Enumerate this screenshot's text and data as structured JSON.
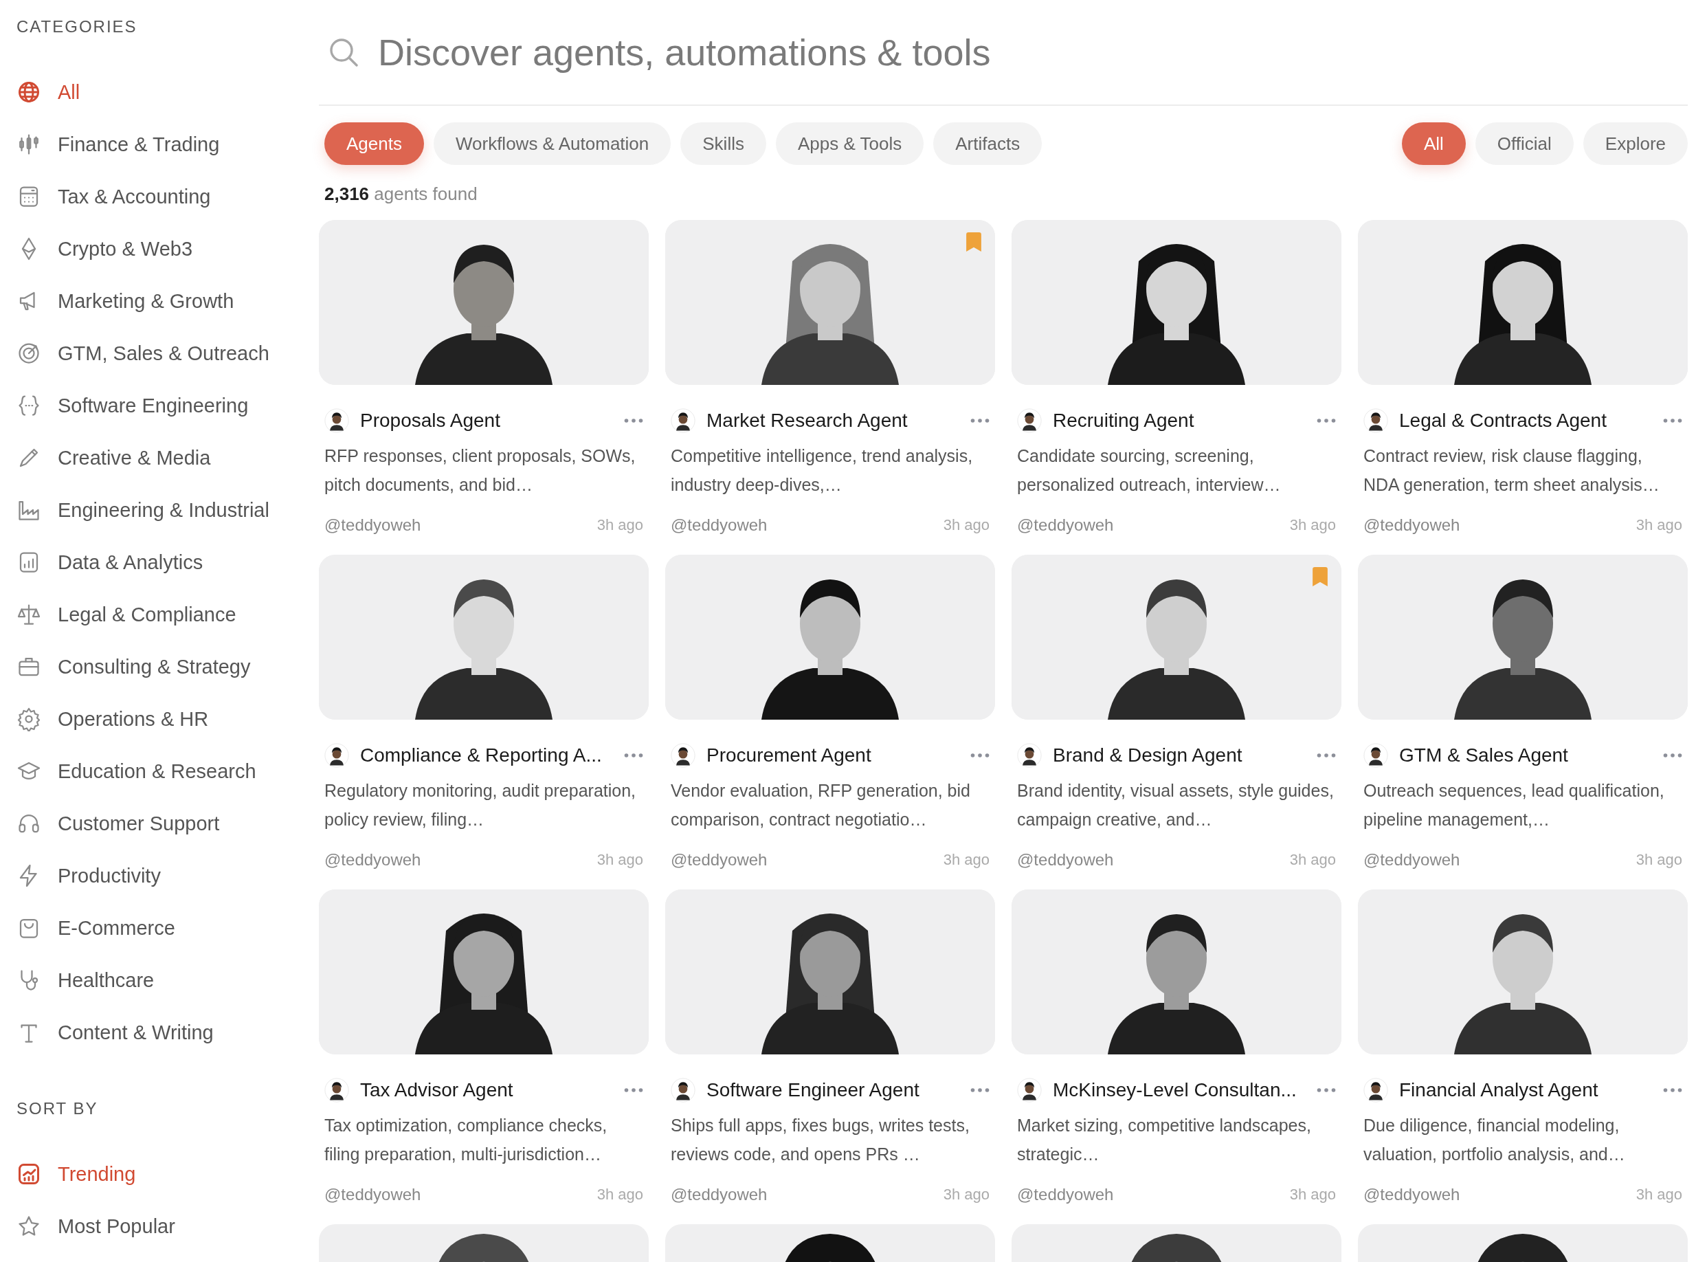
{
  "sidebar": {
    "categories_heading": "CATEGORIES",
    "categories": [
      {
        "label": "All",
        "selected": true
      },
      {
        "label": "Finance & Trading",
        "selected": false
      },
      {
        "label": "Tax & Accounting",
        "selected": false
      },
      {
        "label": "Crypto & Web3",
        "selected": false
      },
      {
        "label": "Marketing & Growth",
        "selected": false
      },
      {
        "label": "GTM, Sales & Outreach",
        "selected": false
      },
      {
        "label": "Software Engineering",
        "selected": false
      },
      {
        "label": "Creative & Media",
        "selected": false
      },
      {
        "label": "Engineering & Industrial",
        "selected": false
      },
      {
        "label": "Data & Analytics",
        "selected": false
      },
      {
        "label": "Legal & Compliance",
        "selected": false
      },
      {
        "label": "Consulting & Strategy",
        "selected": false
      },
      {
        "label": "Operations & HR",
        "selected": false
      },
      {
        "label": "Education & Research",
        "selected": false
      },
      {
        "label": "Customer Support",
        "selected": false
      },
      {
        "label": "Productivity",
        "selected": false
      },
      {
        "label": "E-Commerce",
        "selected": false
      },
      {
        "label": "Healthcare",
        "selected": false
      },
      {
        "label": "Content & Writing",
        "selected": false
      }
    ],
    "sort_heading": "SORT BY",
    "sort": [
      {
        "label": "Trending",
        "selected": true
      },
      {
        "label": "Most Popular",
        "selected": false
      }
    ]
  },
  "search": {
    "placeholder": "Discover agents, automations & tools"
  },
  "tabs": [
    {
      "label": "Agents",
      "selected": true
    },
    {
      "label": "Workflows & Automation",
      "selected": false
    },
    {
      "label": "Skills",
      "selected": false
    },
    {
      "label": "Apps & Tools",
      "selected": false
    },
    {
      "label": "Artifacts",
      "selected": false
    }
  ],
  "filters": [
    {
      "label": "All",
      "selected": true
    },
    {
      "label": "Official",
      "selected": false
    },
    {
      "label": "Explore",
      "selected": false
    }
  ],
  "result_count": "**2,316** agents found",
  "cards": [
    {
      "title": "Proposals Agent",
      "description": "RFP responses, client proposals, SOWs, pitch documents, and bid…",
      "author": "@teddyoweh",
      "time": "3h ago",
      "bookmarked": false
    },
    {
      "title": "Market Research Agent",
      "description": "Competitive intelligence, trend analysis, industry deep-dives,…",
      "author": "@teddyoweh",
      "time": "3h ago",
      "bookmarked": true
    },
    {
      "title": "Recruiting Agent",
      "description": "Candidate sourcing, screening, personalized outreach, interview…",
      "author": "@teddyoweh",
      "time": "3h ago",
      "bookmarked": false
    },
    {
      "title": "Legal & Contracts Agent",
      "description": "Contract review, risk clause flagging, NDA generation, term sheet analysis…",
      "author": "@teddyoweh",
      "time": "3h ago",
      "bookmarked": false
    },
    {
      "title": "Compliance & Reporting A...",
      "description": "Regulatory monitoring, audit preparation, policy review, filing…",
      "author": "@teddyoweh",
      "time": "3h ago",
      "bookmarked": false
    },
    {
      "title": "Procurement Agent",
      "description": "Vendor evaluation, RFP generation, bid comparison, contract negotiatio…",
      "author": "@teddyoweh",
      "time": "3h ago",
      "bookmarked": false
    },
    {
      "title": "Brand & Design Agent",
      "description": "Brand identity, visual assets, style guides, campaign creative, and…",
      "author": "@teddyoweh",
      "time": "3h ago",
      "bookmarked": true
    },
    {
      "title": "GTM & Sales Agent",
      "description": "Outreach sequences, lead qualification, pipeline management,…",
      "author": "@teddyoweh",
      "time": "3h ago",
      "bookmarked": false
    },
    {
      "title": "Tax Advisor Agent",
      "description": "Tax optimization, compliance checks, filing preparation, multi-jurisdiction…",
      "author": "@teddyoweh",
      "time": "3h ago",
      "bookmarked": false
    },
    {
      "title": "Software Engineer Agent",
      "description": "Ships full apps, fixes bugs, writes tests, reviews code, and opens PRs …",
      "author": "@teddyoweh",
      "time": "3h ago",
      "bookmarked": false
    },
    {
      "title": "McKinsey-Level Consultan...",
      "description": "Market sizing, competitive landscapes, strategic…",
      "author": "@teddyoweh",
      "time": "3h ago",
      "bookmarked": false
    },
    {
      "title": "Financial Analyst Agent",
      "description": "Due diligence, financial modeling, valuation, portfolio analysis, and…",
      "author": "@teddyoweh",
      "time": "3h ago",
      "bookmarked": false
    }
  ]
}
